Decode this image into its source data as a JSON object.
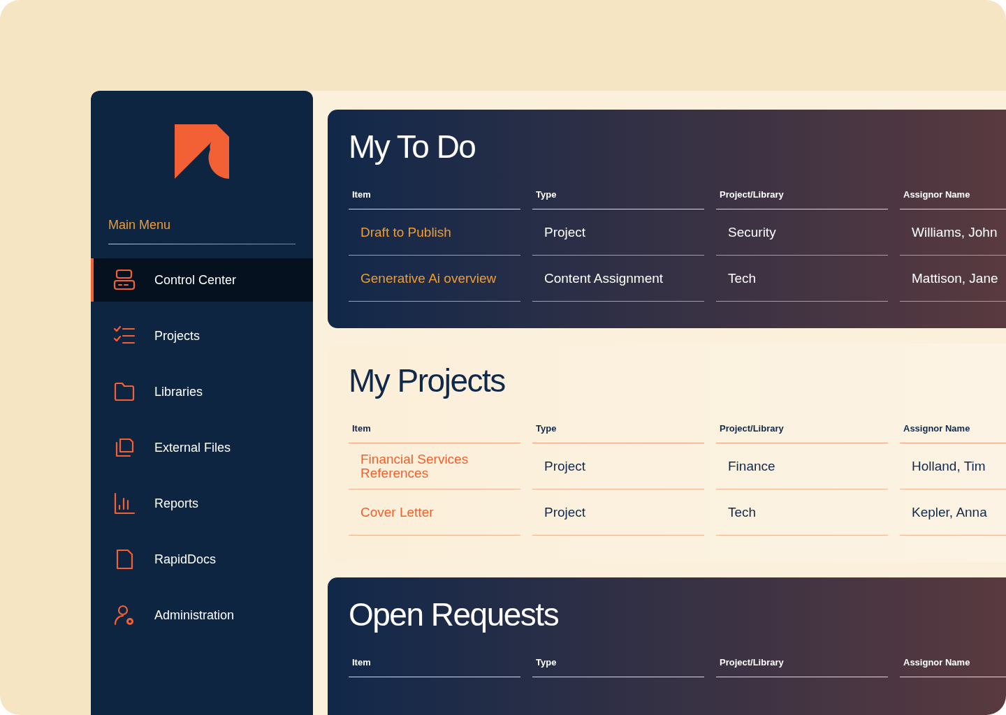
{
  "sidebar": {
    "heading": "Main Menu",
    "items": [
      {
        "label": "Control Center",
        "selected": true
      },
      {
        "label": "Projects",
        "selected": false
      },
      {
        "label": "Libraries",
        "selected": false
      },
      {
        "label": "External Files",
        "selected": false
      },
      {
        "label": "Reports",
        "selected": false
      },
      {
        "label": "RapidDocs",
        "selected": false
      },
      {
        "label": "Administration",
        "selected": false
      }
    ]
  },
  "panels": [
    {
      "kind": "dark",
      "title": "My To Do",
      "columns": [
        "Item",
        "Type",
        "Project/Library",
        "Assignor Name"
      ],
      "rows": [
        [
          "Draft to Publish",
          "Project",
          "Security",
          "Williams, John"
        ],
        [
          "Generative Ai overview",
          "Content Assignment",
          "Tech",
          "Mattison, Jane"
        ]
      ]
    },
    {
      "kind": "light",
      "title": "My Projects",
      "columns": [
        "Item",
        "Type",
        "Project/Library",
        "Assignor Name"
      ],
      "rows": [
        [
          "Financial Services References",
          "Project",
          "Finance",
          "Holland, Tim"
        ],
        [
          "Cover Letter",
          "Project",
          "Tech",
          "Kepler, Anna"
        ]
      ]
    },
    {
      "kind": "dark",
      "title": "Open Requests",
      "columns": [
        "Item",
        "Type",
        "Project/Library",
        "Assignor Name"
      ]
    }
  ]
}
